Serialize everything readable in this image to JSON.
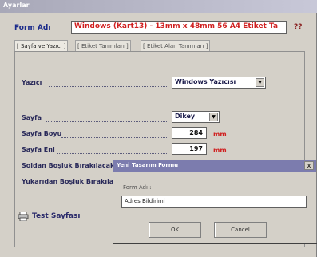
{
  "window": {
    "title": "Ayarlar"
  },
  "form_name": {
    "label": "Form Adı",
    "value": "Windows (Kart13) - 13mm x 48mm 56 A4 Etiket Ta",
    "help": "??"
  },
  "tabs": [
    {
      "label": "[ Sayfa ve Yazıcı ]"
    },
    {
      "label": "[ Etiket Tanımları ]"
    },
    {
      "label": "[ Etiket Alan Tanımları ]"
    }
  ],
  "settings": {
    "printer": {
      "label": "Yazıcı",
      "value": "Windows Yazıcısı"
    },
    "page": {
      "label": "Sayfa",
      "value": "Dikey"
    },
    "page_height": {
      "label": "Sayfa Boyu",
      "value": "284",
      "unit": "mm"
    },
    "page_width": {
      "label": "Sayfa Eni",
      "value": "197",
      "unit": "mm"
    },
    "left_margin": {
      "label": "Soldan Boşluk Bırakılacak"
    },
    "top_margin": {
      "label": "Yukarıdan Boşluk Bırakılacak"
    }
  },
  "test_page": {
    "label": "Test Sayfası"
  },
  "dialog": {
    "title": "Yeni Tasarım Formu",
    "close": "x",
    "field_label": "Form Adı :",
    "field_value": "Adres Bildirimi",
    "ok": "OK",
    "cancel": "Cancel"
  }
}
